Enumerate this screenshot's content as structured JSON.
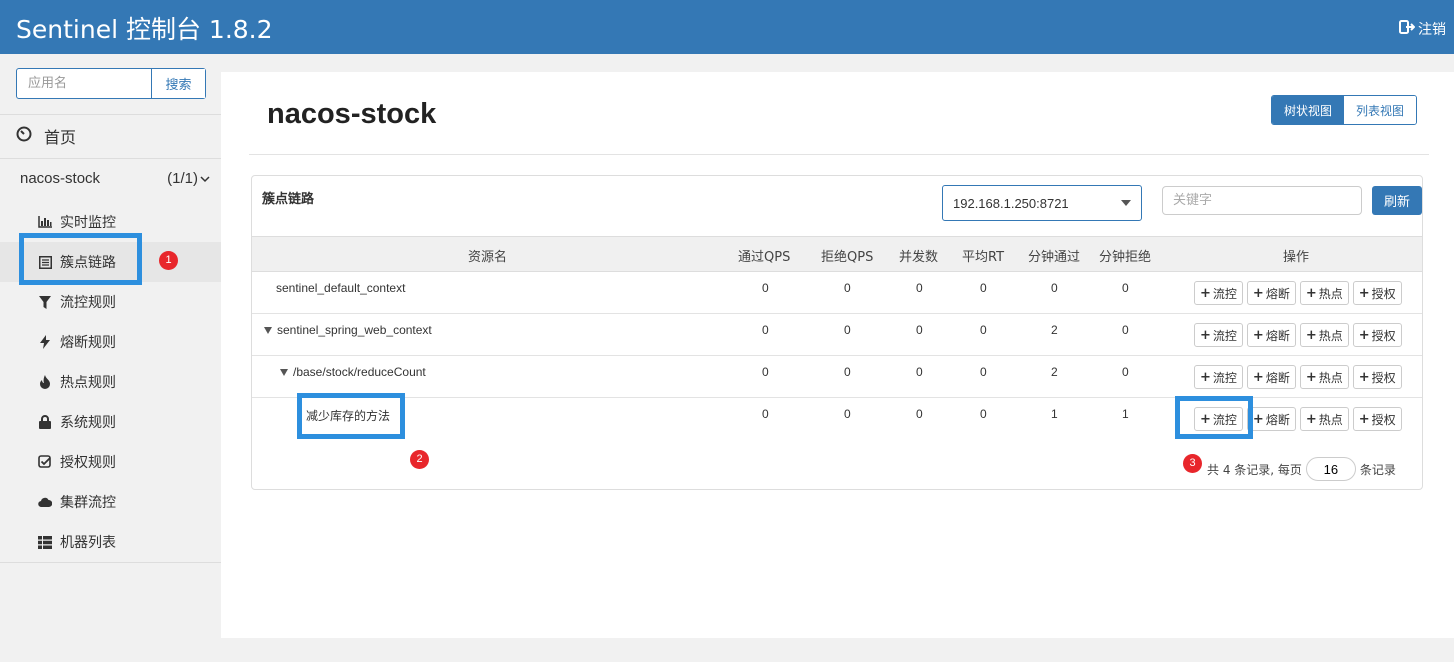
{
  "header": {
    "title": "Sentinel 控制台 1.8.2",
    "logout_label": "注销"
  },
  "sidebar": {
    "search_placeholder": "应用名",
    "search_button": "搜索",
    "home_label": "首页",
    "app_name": "nacos-stock",
    "app_count": "(1/1)",
    "items": [
      {
        "label": "实时监控",
        "icon": "bar-chart-icon"
      },
      {
        "label": "簇点链路",
        "icon": "list-icon"
      },
      {
        "label": "流控规则",
        "icon": "filter-icon"
      },
      {
        "label": "熔断规则",
        "icon": "flash-icon"
      },
      {
        "label": "热点规则",
        "icon": "fire-icon"
      },
      {
        "label": "系统规则",
        "icon": "lock-icon"
      },
      {
        "label": "授权规则",
        "icon": "check-icon"
      },
      {
        "label": "集群流控",
        "icon": "cloud-icon"
      },
      {
        "label": "机器列表",
        "icon": "th-list-icon"
      }
    ],
    "active_index": 1
  },
  "main": {
    "title": "nacos-stock",
    "view_tree": "树状视图",
    "view_list": "列表视图",
    "panel_title": "簇点链路",
    "machine": "192.168.1.250:8721",
    "keyword_placeholder": "关键字",
    "refresh": "刷新",
    "columns": [
      "资源名",
      "通过QPS",
      "拒绝QPS",
      "并发数",
      "平均RT",
      "分钟通过",
      "分钟拒绝",
      "操作"
    ],
    "rows": [
      {
        "name": "sentinel_default_context",
        "level": 0,
        "expanded": false,
        "pass_qps": "0",
        "block_qps": "0",
        "threads": "0",
        "rt": "0",
        "min_pass": "0",
        "min_block": "0"
      },
      {
        "name": "sentinel_spring_web_context",
        "level": 0,
        "expanded": true,
        "pass_qps": "0",
        "block_qps": "0",
        "threads": "0",
        "rt": "0",
        "min_pass": "2",
        "min_block": "0"
      },
      {
        "name": "/base/stock/reduceCount",
        "level": 1,
        "expanded": true,
        "pass_qps": "0",
        "block_qps": "0",
        "threads": "0",
        "rt": "0",
        "min_pass": "2",
        "min_block": "0"
      },
      {
        "name": "减少库存的方法",
        "level": 2,
        "expanded": false,
        "pass_qps": "0",
        "block_qps": "0",
        "threads": "0",
        "rt": "0",
        "min_pass": "1",
        "min_block": "1"
      }
    ],
    "op_buttons": [
      "流控",
      "熔断",
      "热点",
      "授权"
    ],
    "pager": {
      "prefix": "共 4 条记录, 每页",
      "page_size": "16",
      "suffix": "条记录"
    }
  },
  "annotations": [
    "1",
    "2",
    "3"
  ],
  "colors": {
    "header_bg": "#3478b5",
    "highlight": "#2d8fde",
    "badge": "#e8262b"
  }
}
